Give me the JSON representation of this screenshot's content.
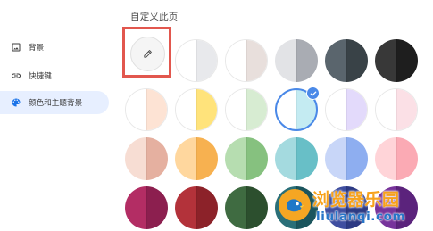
{
  "header": {
    "title": "自定义此页"
  },
  "sidebar": {
    "items": [
      {
        "label": "背景",
        "icon": "image-icon",
        "active": false
      },
      {
        "label": "快捷键",
        "icon": "link-icon",
        "active": false
      },
      {
        "label": "颜色和主题背景",
        "icon": "palette-icon",
        "active": true
      }
    ],
    "accent_color": "#1a73e8"
  },
  "custom_color": {
    "icon": "pencil-icon",
    "highlight_color": "#e2574e"
  },
  "color_swatches": [
    {
      "row": 0,
      "col": 1,
      "left": "#ffffff",
      "right": "#e8e9ec",
      "selected": false
    },
    {
      "row": 0,
      "col": 2,
      "left": "#ffffff",
      "right": "#e8dfdc",
      "selected": false
    },
    {
      "row": 0,
      "col": 3,
      "left": "#e2e3e6",
      "right": "#a9acb3",
      "selected": false
    },
    {
      "row": 0,
      "col": 4,
      "left": "#5a656d",
      "right": "#394247",
      "selected": false
    },
    {
      "row": 0,
      "col": 5,
      "left": "#383838",
      "right": "#1e1e1e",
      "selected": false
    },
    {
      "row": 1,
      "col": 0,
      "left": "#ffffff",
      "right": "#fde3d4",
      "selected": false
    },
    {
      "row": 1,
      "col": 1,
      "left": "#ffffff",
      "right": "#ffe37b",
      "selected": false
    },
    {
      "row": 1,
      "col": 2,
      "left": "#ffffff",
      "right": "#d7ecd2",
      "selected": false
    },
    {
      "row": 1,
      "col": 3,
      "left": "#ffffff",
      "right": "#c4ebf2",
      "selected": true
    },
    {
      "row": 1,
      "col": 4,
      "left": "#ffffff",
      "right": "#e3dafb",
      "selected": false
    },
    {
      "row": 1,
      "col": 5,
      "left": "#ffffff",
      "right": "#fbe0e6",
      "selected": false
    },
    {
      "row": 2,
      "col": 0,
      "left": "#f7ddd3",
      "right": "#e5b0a0",
      "selected": false
    },
    {
      "row": 2,
      "col": 1,
      "left": "#ffd79e",
      "right": "#f7b150",
      "selected": false
    },
    {
      "row": 2,
      "col": 2,
      "left": "#b6ddb0",
      "right": "#86c17f",
      "selected": false
    },
    {
      "row": 2,
      "col": 3,
      "left": "#a4dadf",
      "right": "#68bfc7",
      "selected": false
    },
    {
      "row": 2,
      "col": 4,
      "left": "#c8d6f8",
      "right": "#8eaef0",
      "selected": false
    },
    {
      "row": 2,
      "col": 5,
      "left": "#ffd4d8",
      "right": "#fbaab4",
      "selected": false
    },
    {
      "row": 3,
      "col": 0,
      "left": "#b32d64",
      "right": "#8c1f4f",
      "selected": false
    },
    {
      "row": 3,
      "col": 1,
      "left": "#b3323a",
      "right": "#8c2229",
      "selected": false
    },
    {
      "row": 3,
      "col": 2,
      "left": "#3f6b41",
      "right": "#2c4f2e",
      "selected": false
    },
    {
      "row": 3,
      "col": 3,
      "left": "#2a6f78",
      "right": "#1b555d",
      "selected": false
    },
    {
      "row": 3,
      "col": 4,
      "left": "#3f4ea0",
      "right": "#2d3a84",
      "selected": false
    },
    {
      "row": 3,
      "col": 5,
      "left": "#77339b",
      "right": "#5b237c",
      "selected": false
    }
  ],
  "selection_badge": {
    "icon": "check-icon",
    "color": "#4a89e8"
  },
  "watermark": {
    "title": "浏览器乐园",
    "url": "liulanqi.com",
    "logo_icon": "browser-park-logo-icon",
    "title_color": "#f7a21b",
    "url_color": "#2775c8"
  }
}
